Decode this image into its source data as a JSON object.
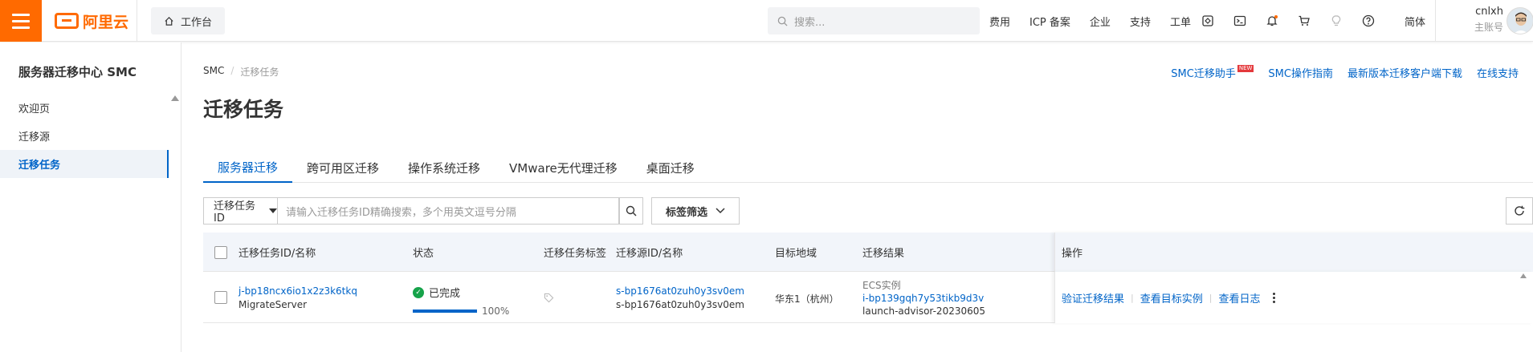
{
  "topbar": {
    "logo_text": "阿里云",
    "workbench_label": "工作台",
    "search_placeholder": "搜索...",
    "nav_links": [
      "费用",
      "ICP 备案",
      "企业",
      "支持",
      "工单"
    ],
    "language": "简体",
    "user_name": "cnlxh",
    "account_type": "主账号",
    "brand_color": "#ff6a00"
  },
  "sidebar": {
    "title": "服务器迁移中心 SMC",
    "items": [
      {
        "label": "欢迎页"
      },
      {
        "label": "迁移源"
      },
      {
        "label": "迁移任务"
      }
    ]
  },
  "main": {
    "breadcrumb": [
      "SMC",
      "迁移任务"
    ],
    "breadcrumb_sep": "/",
    "top_links": {
      "assistant": "SMC迁移助手",
      "new_badge": "NEW",
      "guide": "SMC操作指南",
      "download": "最新版本迁移客户端下载",
      "support": "在线支持"
    },
    "page_title": "迁移任务",
    "tabs": [
      {
        "label": "服务器迁移"
      },
      {
        "label": "跨可用区迁移"
      },
      {
        "label": "操作系统迁移"
      },
      {
        "label": "VMware无代理迁移"
      },
      {
        "label": "桌面迁移"
      }
    ],
    "filter": {
      "select_value": "迁移任务ID",
      "input_placeholder": "请输入迁移任务ID精确搜索，多个用英文逗号分隔",
      "tag_filter_label": "标签筛选"
    },
    "table": {
      "headers": {
        "task": "迁移任务ID/名称",
        "status": "状态",
        "tags": "迁移任务标签",
        "source": "迁移源ID/名称",
        "region": "目标地域",
        "result": "迁移结果",
        "actions": "操作"
      },
      "rows": [
        {
          "task_id": "j-bp18ncx6io1x2z3k6tkq",
          "task_name": "MigrateServer",
          "status": "已完成",
          "progress_percent": 100,
          "progress_text": "100%",
          "source_id": "s-bp1676at0zuh0y3sv0em",
          "source_name": "s-bp1676at0zuh0y3sv0em",
          "region": "华东1（杭州）",
          "result_type": "ECS实例",
          "result_instance_id": "i-bp139gqh7y53tikb9d3v",
          "result_name": "launch-advisor-20230605",
          "actions": {
            "verify": "验证迁移结果",
            "view_instance": "查看目标实例",
            "view_log": "查看日志"
          }
        }
      ]
    }
  }
}
